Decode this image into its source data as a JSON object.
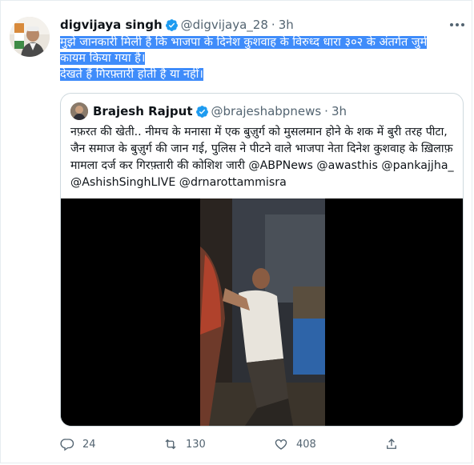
{
  "tweet": {
    "author_name": "digvijaya singh",
    "author_handle": "@digvijaya_28",
    "time": "3h",
    "text_line1": "मुझे जानकारी मिली है कि भाजपा के दिनेश कुशवाह के विरुध्द धारा ३०२ के अंतर्गत जुर्म",
    "text_line2": "कायम किया गया है।",
    "text_line3": "देखते हैं गिरफ़्तारी होती है या नहीं।"
  },
  "quote": {
    "author_name": "Brajesh Rajput",
    "author_handle": "@brajeshabpnews",
    "time": "3h",
    "text": "नफ़रत की खेती.. नीमच के मनासा में एक बुज़ुर्ग को मुसलमान होने के शक में बुरी तरह पीटा, जैन समाज के बुज़ुर्ग की जान गई, पुलिस ने पीटने वाले भाजपा नेता दिनेश कुशवाह के ख़िलाफ़ मामला दर्ज कर गिरफ़्तारी की कोशिश जारी @ABPNews @awasthis @pankajjha_ @AshishSinghLIVE @drnarottammisra"
  },
  "actions": {
    "reply_count": "24",
    "retweet_count": "130",
    "like_count": "408"
  },
  "icons": [
    "verified-badge-icon",
    "more-options-icon",
    "reply-icon",
    "retweet-icon",
    "like-icon",
    "share-icon"
  ],
  "colors": {
    "verified": "#1d9bf0",
    "highlight": "#3f8cfa",
    "secondary_text": "#536471",
    "border": "#cfd9de"
  }
}
